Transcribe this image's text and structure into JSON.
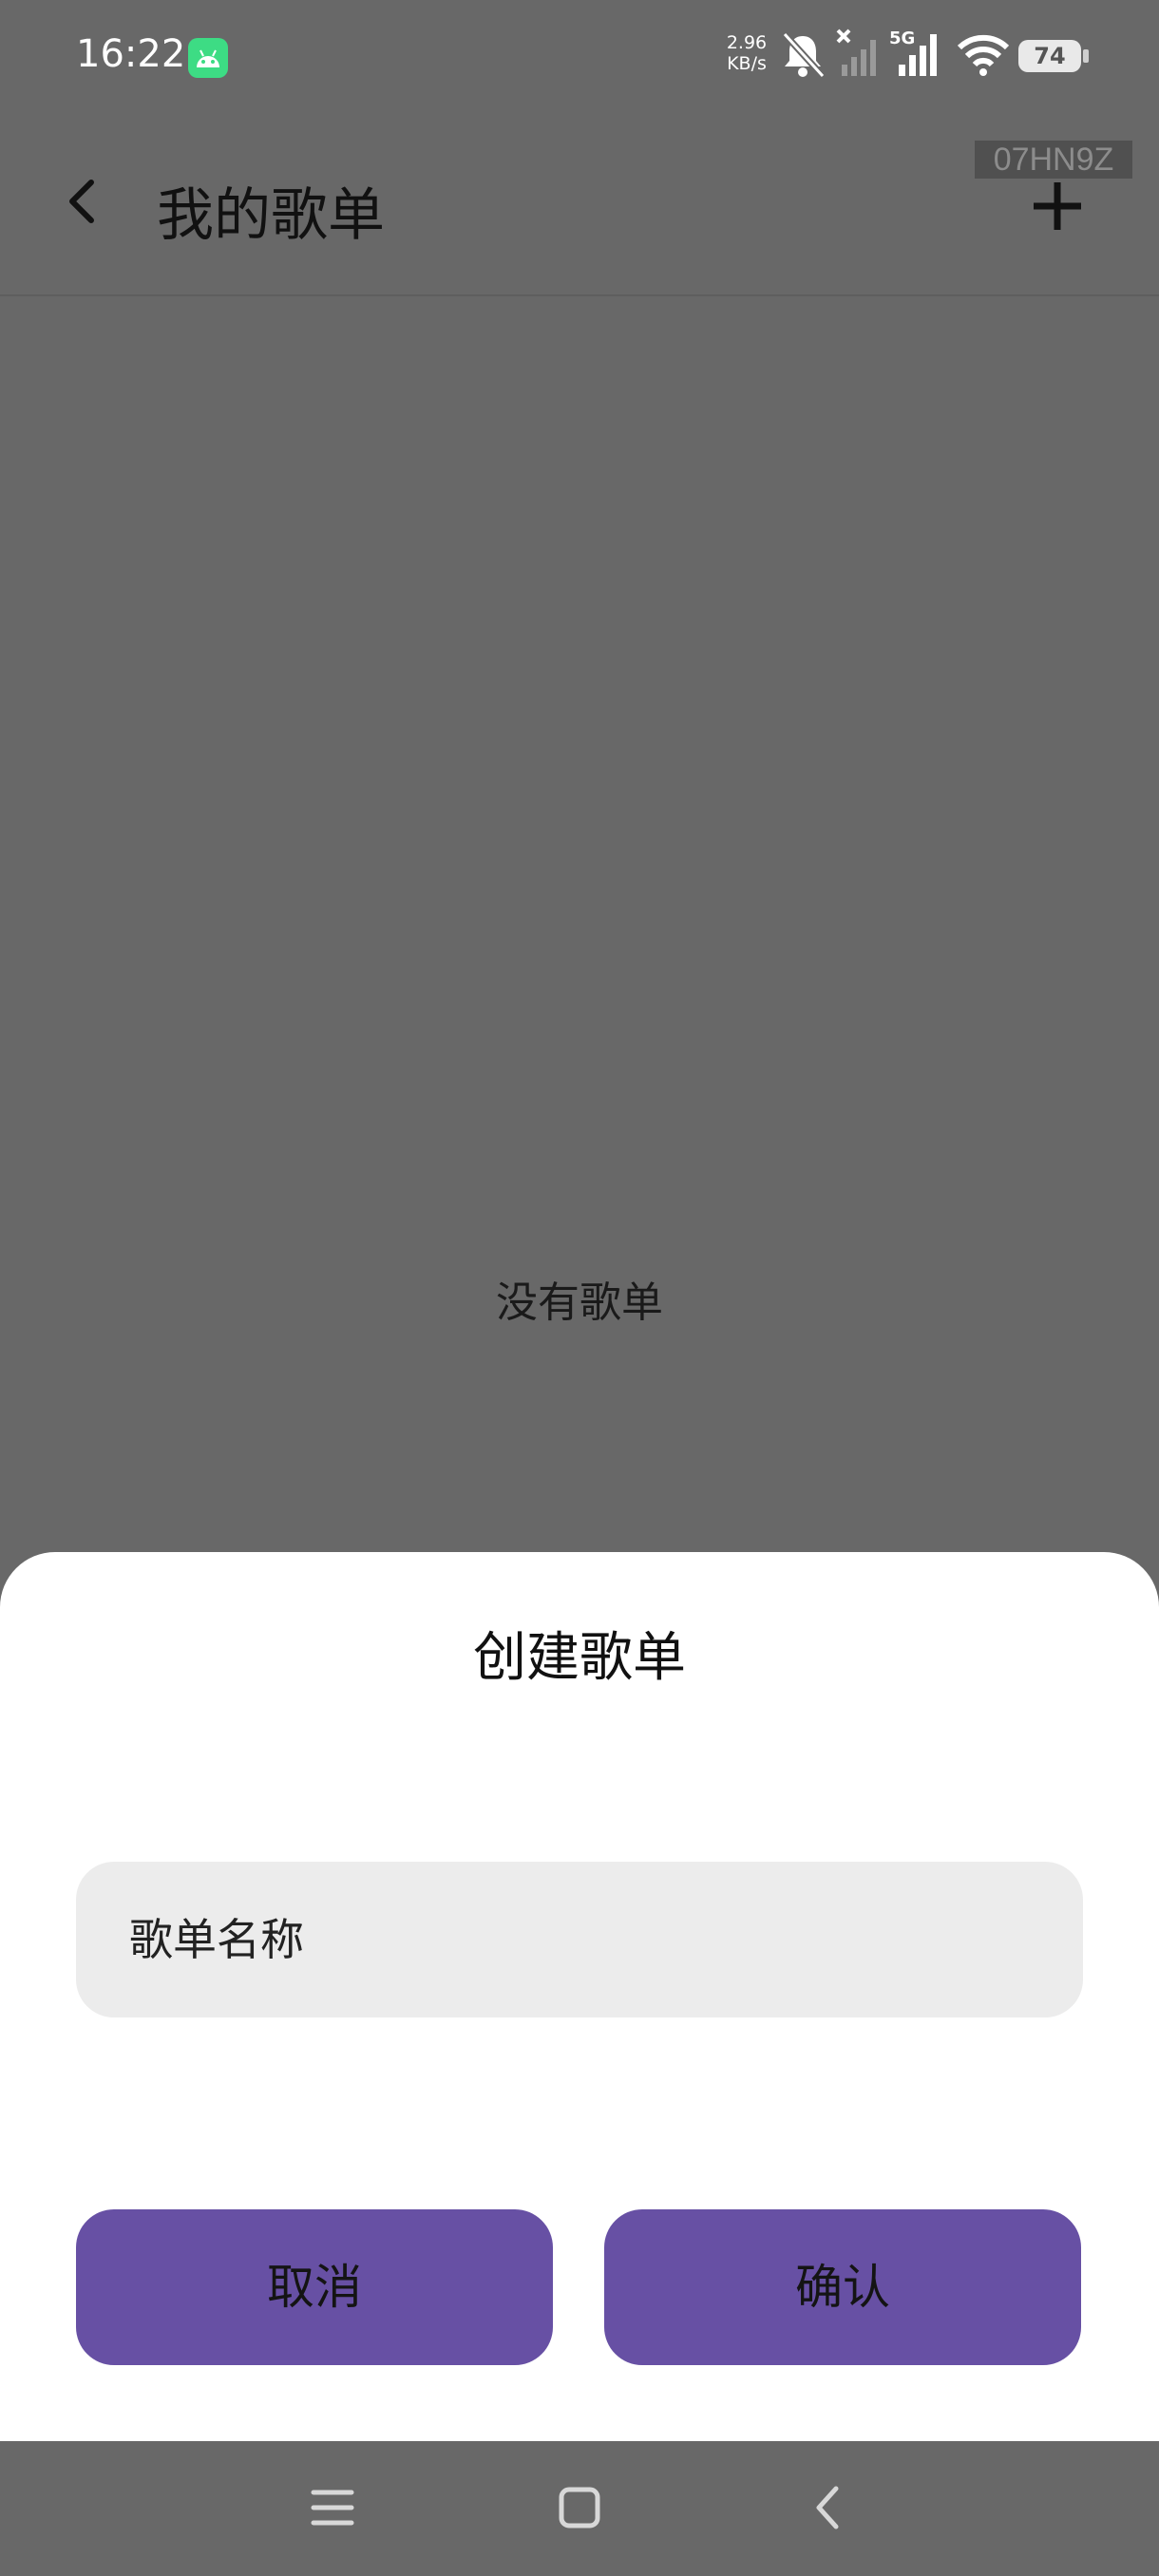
{
  "status_bar": {
    "time": "16:22",
    "net_speed_value": "2.96",
    "net_speed_unit": "KB/s",
    "network_type": "5G",
    "battery_level": "74",
    "icons": [
      "android-notification-icon",
      "bell-muted-icon",
      "signal-no-sim-icon",
      "signal-5g-icon",
      "wifi-icon",
      "battery-icon"
    ]
  },
  "app_bar": {
    "title": "我的歌单",
    "device_tag": "07HN9Z",
    "icons": [
      "back-arrow-icon",
      "plus-icon"
    ]
  },
  "content": {
    "empty_message": "没有歌单"
  },
  "dialog": {
    "title": "创建歌单",
    "input_placeholder": "歌单名称",
    "input_value": "",
    "cancel_label": "取消",
    "confirm_label": "确认",
    "button_color": "#6750a4"
  },
  "nav_bar": {
    "icons": [
      "menu-icon",
      "home-icon",
      "back-icon"
    ]
  },
  "colors": {
    "scrim": "#686868",
    "sheet": "#ffffff",
    "input_bg": "#ececec",
    "accent": "#6750a4"
  }
}
